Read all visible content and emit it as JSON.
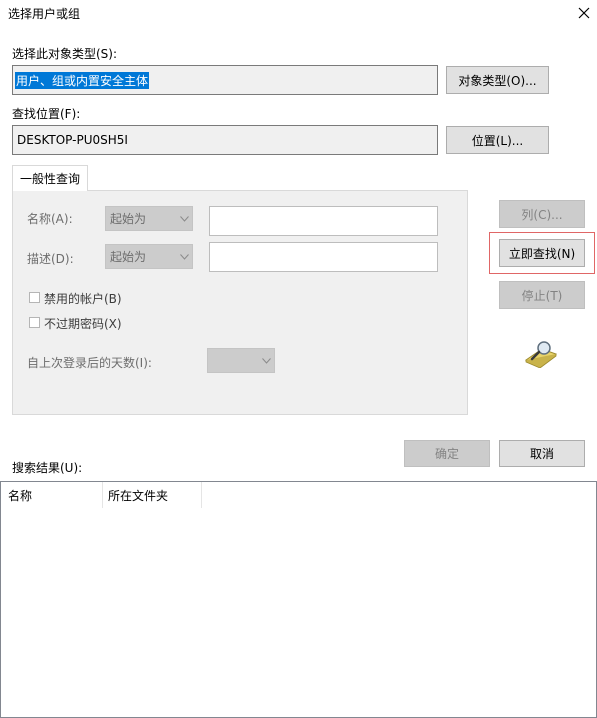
{
  "window": {
    "title": "选择用户或组"
  },
  "object_type": {
    "label": "选择此对象类型(S):",
    "value": "用户、组或内置安全主体",
    "button": "对象类型(O)..."
  },
  "location": {
    "label": "查找位置(F):",
    "value": "DESKTOP-PU0SH5I",
    "button": "位置(L)..."
  },
  "query_tab": {
    "label": "一般性查询"
  },
  "name_row": {
    "label": "名称(A):",
    "combo": "起始为",
    "value": ""
  },
  "desc_row": {
    "label": "描述(D):",
    "combo": "起始为",
    "value": ""
  },
  "checkboxes": [
    {
      "label": "禁用的帐户(B)",
      "checked": false
    },
    {
      "label": "不过期密码(X)",
      "checked": false
    }
  ],
  "days_row": {
    "label": "自上次登录后的天数(I):",
    "value": ""
  },
  "buttons": {
    "columns": "列(C)...",
    "find_now": "立即查找(N)",
    "stop": "停止(T)",
    "ok": "确定",
    "cancel": "取消"
  },
  "results": {
    "label": "搜索结果(U):",
    "columns": [
      "名称",
      "所在文件夹"
    ]
  },
  "colors": {
    "highlight": "#0078d7",
    "annotation_box": "#e06666"
  }
}
